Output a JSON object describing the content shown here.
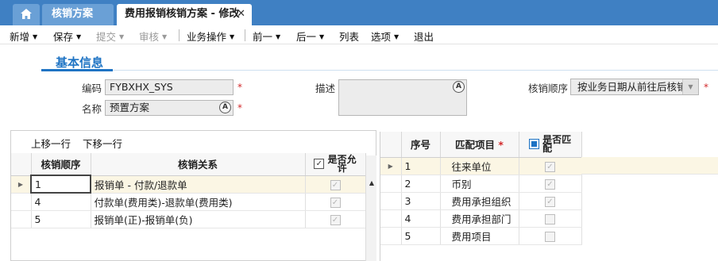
{
  "tabs": {
    "home_icon": "home-icon",
    "inactive_label": "核销方案",
    "active_label": "费用报销核销方案 - 修改",
    "close_glyph": "✕"
  },
  "toolbar": {
    "items": [
      {
        "label": "新增",
        "dropdown": true,
        "enabled": true
      },
      {
        "label": "保存",
        "dropdown": true,
        "enabled": true
      },
      {
        "label": "提交",
        "dropdown": true,
        "enabled": false
      },
      {
        "label": "审核",
        "dropdown": true,
        "enabled": false
      },
      {
        "label": "业务操作",
        "dropdown": true,
        "enabled": true
      },
      {
        "label": "前一",
        "dropdown": true,
        "enabled": true
      },
      {
        "label": "后一",
        "dropdown": true,
        "enabled": true
      },
      {
        "label": "列表",
        "dropdown": false,
        "enabled": true
      },
      {
        "label": "选项",
        "dropdown": true,
        "enabled": true
      },
      {
        "label": "退出",
        "dropdown": false,
        "enabled": true
      }
    ]
  },
  "section": {
    "title": "基本信息"
  },
  "form": {
    "code_label": "编码",
    "code_value": "FYBXHX_SYS",
    "name_label": "名称",
    "name_value": "预置方案",
    "desc_label": "描述",
    "desc_value": "",
    "order_label": "核销顺序",
    "order_value": "按业务日期从前往后核销",
    "required_mark": "*"
  },
  "left_panel": {
    "toolbar": {
      "move_up": "上移一行",
      "move_down": "下移一行"
    },
    "columns": {
      "seq": "核销顺序",
      "relation": "核销关系",
      "allow_top": "是否允",
      "allow_bottom": "许"
    },
    "rows": [
      {
        "seq": "1",
        "relation": "报销单 - 付款/退款单",
        "allowed": true
      },
      {
        "seq": "4",
        "relation": "付款单(费用类)-退款单(费用类)",
        "allowed": true
      },
      {
        "seq": "5",
        "relation": "报销单(正)-报销单(负)",
        "allowed": true
      }
    ]
  },
  "right_panel": {
    "columns": {
      "seq": "序号",
      "item": "匹配项目",
      "match_top": "是否匹",
      "match_bottom": "配"
    },
    "rows": [
      {
        "seq": "1",
        "item": "往来单位",
        "matched": true
      },
      {
        "seq": "2",
        "item": "币别",
        "matched": true
      },
      {
        "seq": "3",
        "item": "费用承担组织",
        "matched": true
      },
      {
        "seq": "4",
        "item": "费用承担部门",
        "matched": false
      },
      {
        "seq": "5",
        "item": "费用项目",
        "matched": false
      }
    ]
  }
}
